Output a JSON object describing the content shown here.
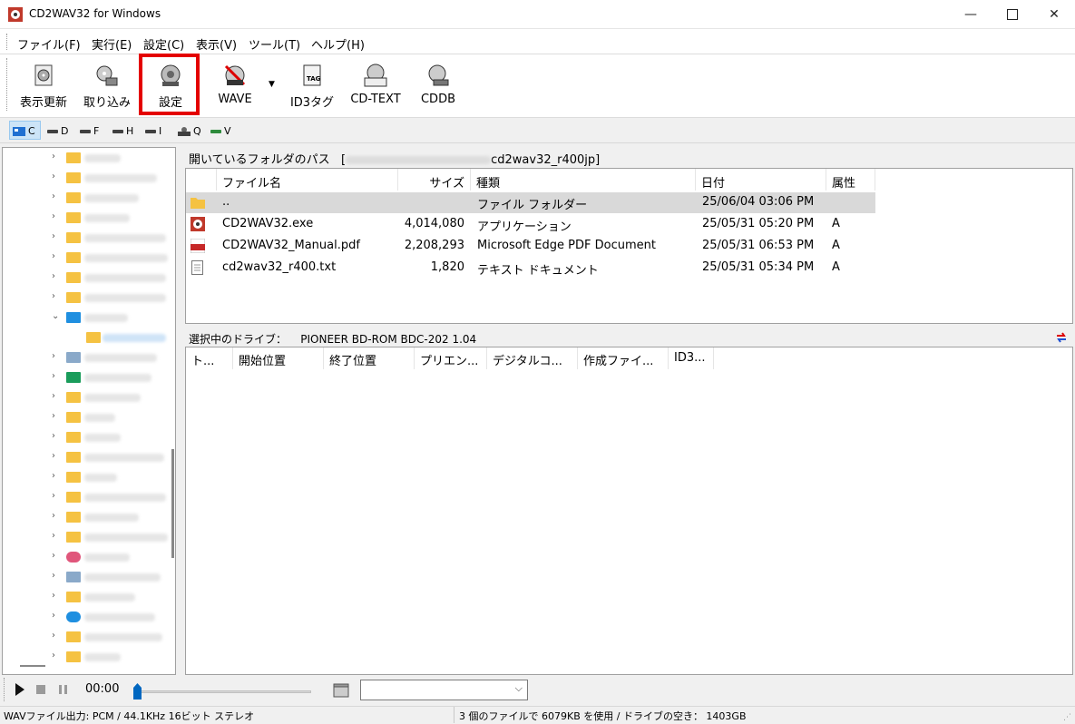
{
  "window": {
    "title": "CD2WAV32 for Windows"
  },
  "menu": [
    {
      "label": "ファイル(F)"
    },
    {
      "label": "実行(E)"
    },
    {
      "label": "設定(C)"
    },
    {
      "label": "表示(V)"
    },
    {
      "label": "ツール(T)"
    },
    {
      "label": "ヘルプ(H)"
    }
  ],
  "toolbar": {
    "refresh": "表示更新",
    "rip": "取り込み",
    "settings": "設定",
    "wave": "WAVE",
    "id3": "ID3タグ",
    "cdtext": "CD-TEXT",
    "cddb": "CDDB"
  },
  "drives": [
    "C",
    "D",
    "F",
    "H",
    "I",
    "Q",
    "V"
  ],
  "path": {
    "label": "開いているフォルダのパス",
    "value": "[",
    "value_end": "cd2wav32_r400jp]"
  },
  "filelist": {
    "headers": {
      "name": "ファイル名",
      "size": "サイズ",
      "type": "種類",
      "date": "日付",
      "attr": "属性"
    },
    "rows": [
      {
        "name": "..",
        "size": "",
        "type": "ファイル フォルダー",
        "date": "25/06/04 03:06 PM",
        "attr": "",
        "icon": "folder-icon"
      },
      {
        "name": "CD2WAV32.exe",
        "size": "4,014,080",
        "type": "アプリケーション",
        "date": "25/05/31 05:20 PM",
        "attr": "A",
        "icon": "app-icon"
      },
      {
        "name": "CD2WAV32_Manual.pdf",
        "size": "2,208,293",
        "type": "Microsoft Edge PDF Document",
        "date": "25/05/31 06:53 PM",
        "attr": "A",
        "icon": "pdf-icon"
      },
      {
        "name": "cd2wav32_r400.txt",
        "size": "1,820",
        "type": "テキスト ドキュメント",
        "date": "25/05/31 05:34 PM",
        "attr": "A",
        "icon": "text-file-icon"
      }
    ]
  },
  "drive_info": {
    "label": "選択中のドライブ：",
    "value": "PIONEER BD-ROM  BDC-202 1.04"
  },
  "tracklist": {
    "headers": [
      "ト...",
      "開始位置",
      "終了位置",
      "プリエン...",
      "デジタルコ...",
      "作成ファイ...",
      "ID3..."
    ]
  },
  "player": {
    "time": "00:00",
    "seek_fraction": 0.0
  },
  "status": {
    "left": "WAVファイル出力: PCM / 44.1KHz 16ビット ステレオ",
    "right": "3 個のファイルで 6079KB を使用 / ドライブの空き： 1403GB"
  },
  "colors": {
    "highlight": "#e40000",
    "selection": "#d9d9d9",
    "folder": "#f5c242"
  }
}
